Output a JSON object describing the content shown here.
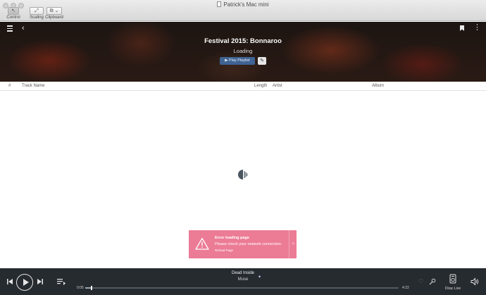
{
  "window": {
    "title": "Patrick's Mac mini",
    "toolbar": [
      {
        "label": "Control",
        "glyph": "↖"
      },
      {
        "label": "Scaling",
        "glyph": "⤢"
      },
      {
        "label": "Clipboard",
        "glyph": "⧉ ⌄"
      }
    ]
  },
  "header": {
    "playlist_title": "Festival 2015: Bonnaroo",
    "status": "Loading",
    "play_button": "▶  Play Playlist",
    "edit_button": "✎",
    "back_icon": "‹",
    "more_icon": "⋮"
  },
  "table": {
    "columns": {
      "index": "#",
      "track": "Track Name",
      "length": "Length",
      "artist": "Artist",
      "album": "Album"
    }
  },
  "error_toast": {
    "title": "Error loading page",
    "message": "Please check your network connection.",
    "action": "Reload Page",
    "close": "✕",
    "color": "#ec7b96"
  },
  "player": {
    "song": "Dead Inside",
    "artist": "Muse",
    "elapsed": "0:05",
    "total": "4:22",
    "progress": 0.019,
    "dirac_label": "Dirac Live",
    "heart_icon": "♡",
    "star_icon": "✦"
  },
  "icons": [
    "menu-icon",
    "back-icon",
    "bookmark-icon",
    "more-icon",
    "spinner-icon",
    "warning-icon",
    "prev-icon",
    "play-icon",
    "next-icon",
    "queue-icon",
    "heart-icon",
    "mic-icon",
    "dirac-icon",
    "volume-icon"
  ]
}
